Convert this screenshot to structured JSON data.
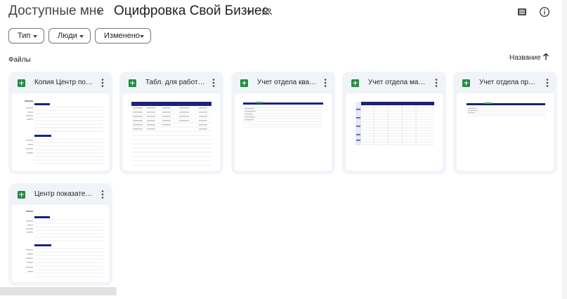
{
  "breadcrumb": {
    "root": "Доступные мне",
    "separator": "›",
    "current": "Оцифровка Свой Бизнес"
  },
  "filters": [
    {
      "label": "Тип"
    },
    {
      "label": "Люди"
    },
    {
      "label": "Изменено"
    }
  ],
  "section": {
    "label": "Файлы",
    "sort_label": "Название"
  },
  "files": [
    {
      "title": "Копия Центр по…",
      "icon": "google-sheets-icon"
    },
    {
      "title": "Табл. для работ…",
      "icon": "google-sheets-icon"
    },
    {
      "title": "Учет отдела ква…",
      "icon": "google-sheets-icon"
    },
    {
      "title": "Учет отдела ма…",
      "icon": "google-sheets-icon"
    },
    {
      "title": "Учет отдела пр…",
      "icon": "google-sheets-icon"
    },
    {
      "title": "Центр показате…",
      "icon": "google-sheets-icon"
    }
  ],
  "colors": {
    "card_bg": "#f0f4f9",
    "sheets_green": "#1e8e3e",
    "thumb_header_blue": "#1a237e"
  }
}
